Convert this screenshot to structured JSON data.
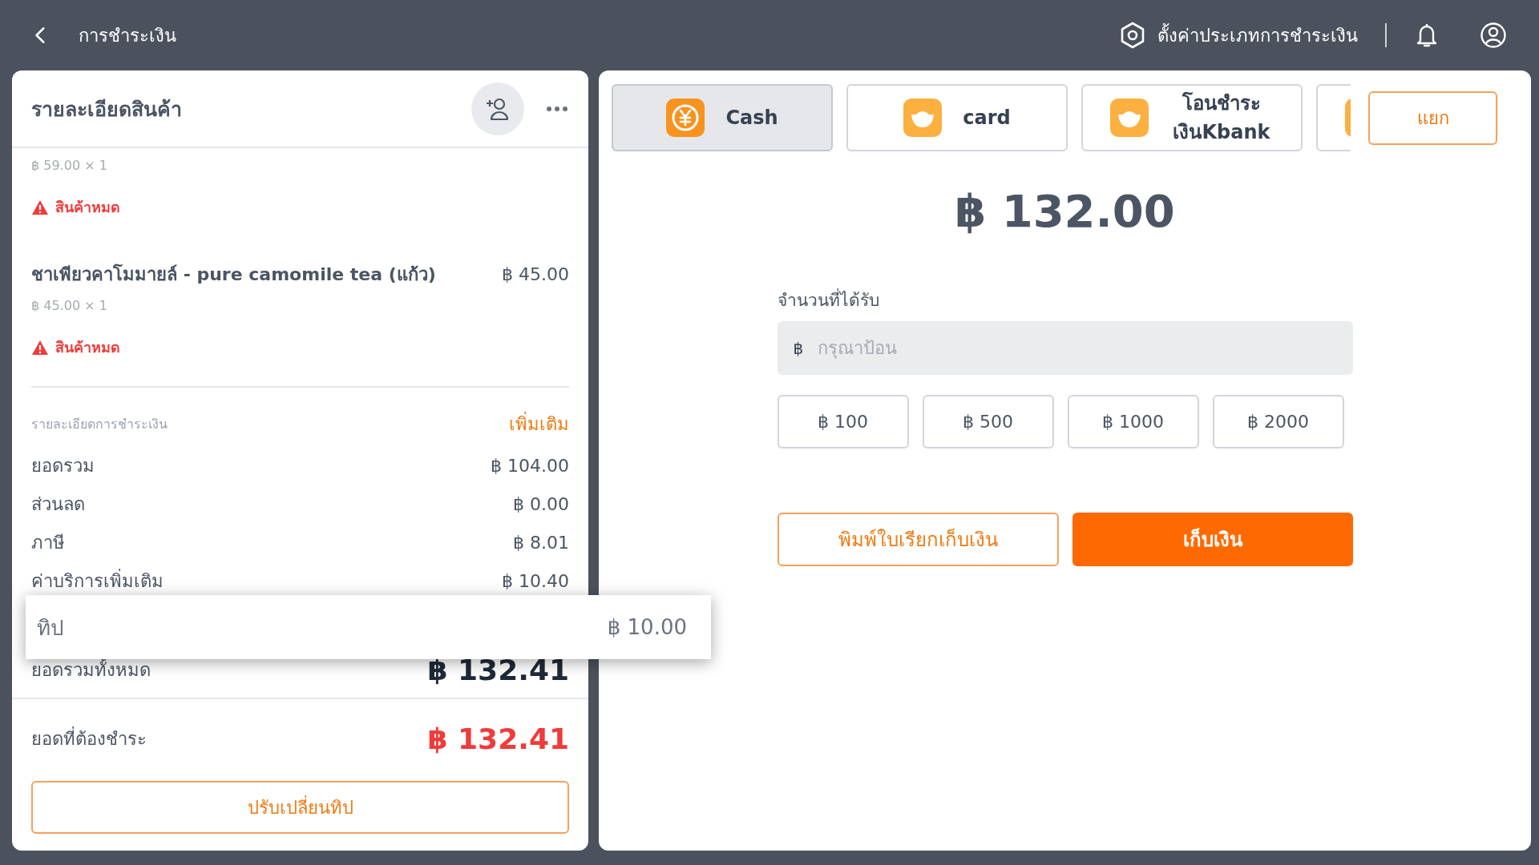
{
  "header": {
    "title": "การชำระเงิน",
    "settings_label": "ตั้งค่าประเภทการชำระเงิน"
  },
  "order": {
    "title": "รายละเอียดสินค้า",
    "items": [
      {
        "qty_line": "฿ 59.00 × 1",
        "warning": "สินค้าหมด"
      },
      {
        "name": "ชาเพียวคาโมมายล์ - pure camomile tea (แก้ว)",
        "price": "฿ 45.00",
        "qty_line": "฿ 45.00 × 1",
        "warning": "สินค้าหมด"
      }
    ],
    "summary_title": "รายละเอียดการชำระเงิน",
    "more_link": "เพิ่มเติม",
    "rows": [
      {
        "kind": "plain",
        "label": "ยอดรวม",
        "value": "฿ 104.00"
      },
      {
        "kind": "plain",
        "label": "ส่วนลด",
        "value": "฿ 0.00"
      },
      {
        "kind": "plain",
        "label": "ภาษี",
        "value": "฿ 8.01"
      },
      {
        "kind": "plain",
        "label": "ค่าบริการเพิ่มเติม",
        "value": "฿ 10.40"
      },
      {
        "kind": "popup",
        "label": "ทิป",
        "value": "฿ 10.00"
      },
      {
        "kind": "total",
        "label": "ยอดรวมทั้งหมด",
        "value": "฿ 132.41"
      }
    ],
    "due": {
      "label": "ยอดที่ต้องชำระ",
      "value": "฿ 132.41"
    },
    "change_tip_button": "ปรับเปลี่ยนทิป"
  },
  "payment": {
    "methods": [
      {
        "kind": "cash",
        "label": "Cash",
        "selected": true
      },
      {
        "kind": "other",
        "label": "card",
        "selected": false
      },
      {
        "kind": "other",
        "label": "โอนชำระเงินKbank",
        "selected": false
      },
      {
        "kind": "other",
        "selected": false
      }
    ],
    "split_button": "แยก",
    "amount": "฿ 132.00",
    "received_label": "จำนวนที่ได้รับ",
    "currency": "฿",
    "placeholder": "กรุณาป้อน",
    "quick_amounts": [
      "฿ 100",
      "฿ 500",
      "฿ 1000",
      "฿ 2000"
    ],
    "print_button": "พิมพ์ใบเรียกเก็บเงิน",
    "collect_button": "เก็บเงิน"
  }
}
